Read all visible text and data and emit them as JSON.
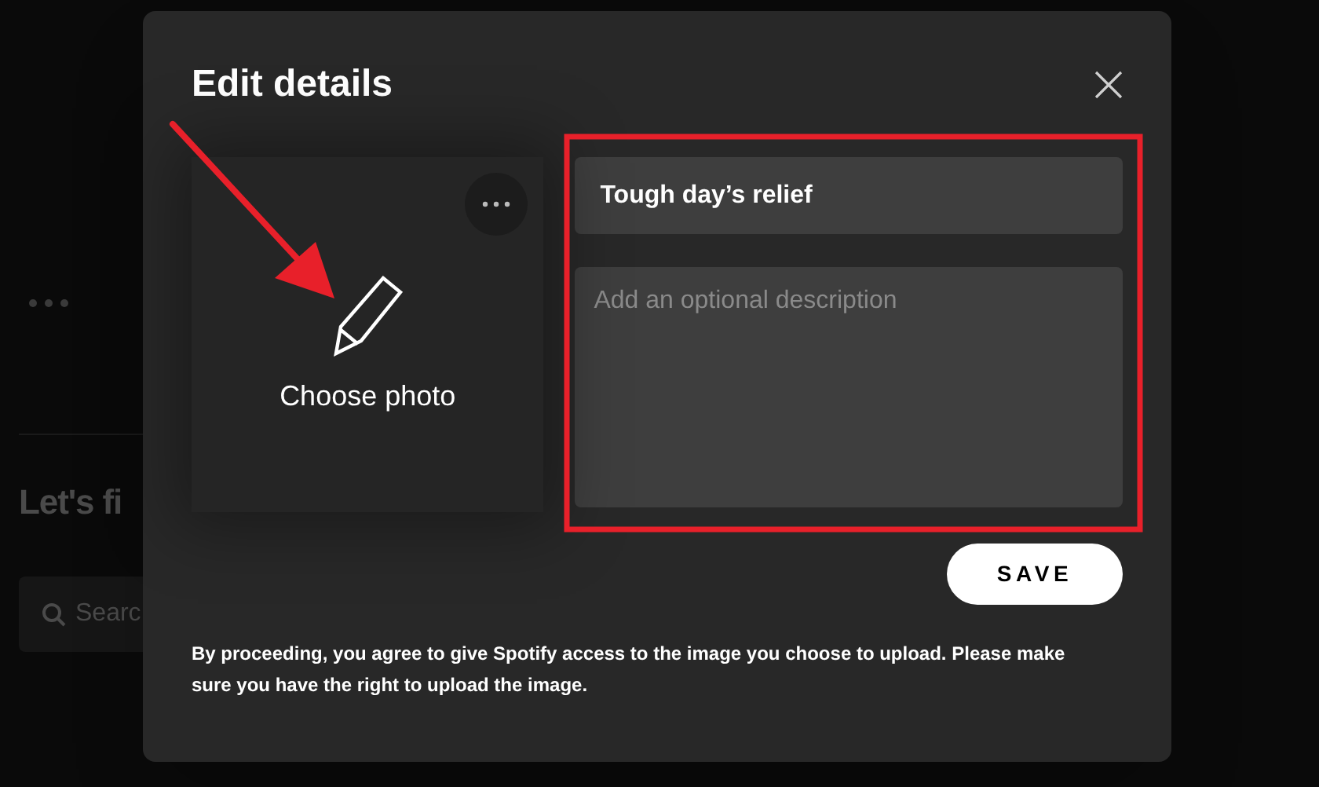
{
  "background": {
    "heading": "Let's fi",
    "search": {
      "placeholder": "Searc"
    }
  },
  "dialog": {
    "title": "Edit details",
    "photo": {
      "label": "Choose photo"
    },
    "name_field": {
      "value": "Tough day’s relief"
    },
    "description_field": {
      "placeholder": "Add an optional description"
    },
    "save_button": "SAVE",
    "disclaimer": "By proceeding, you agree to give Spotify access to the image you choose to upload. Please make sure you have the right to upload the image."
  }
}
